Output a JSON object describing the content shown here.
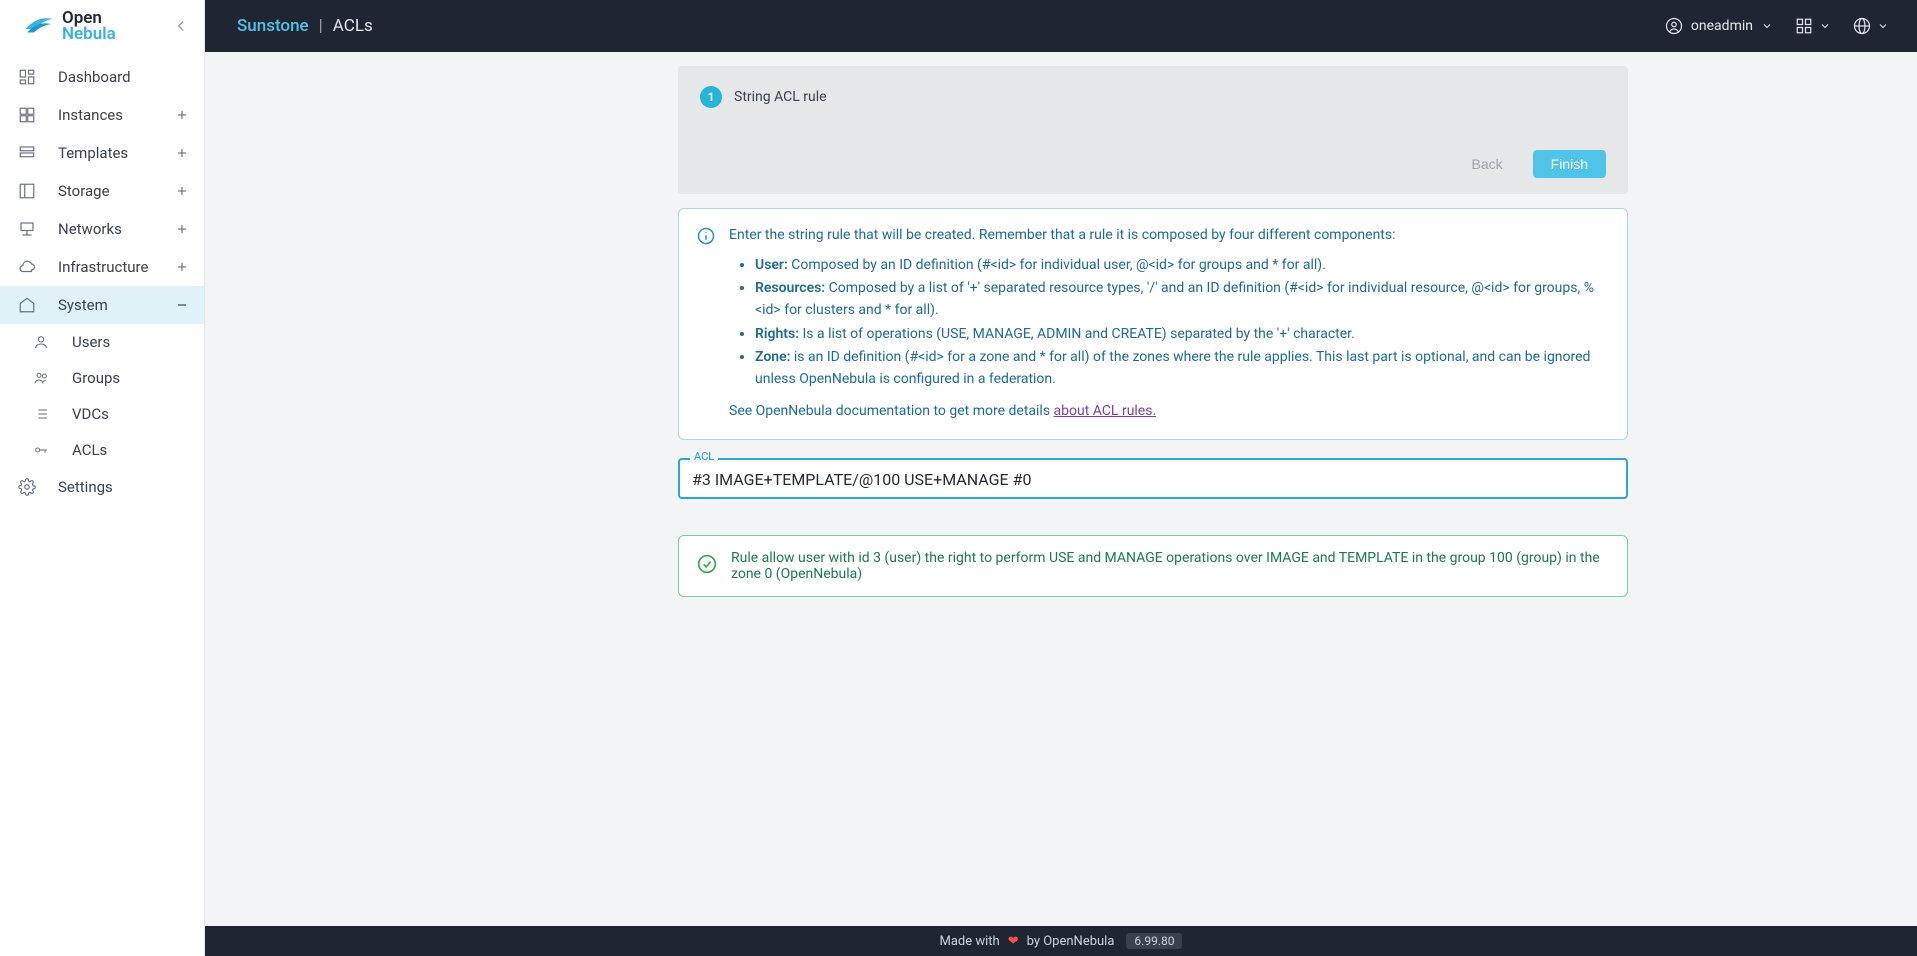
{
  "app": {
    "open": "Open",
    "nebula": "Nebula"
  },
  "breadcrumb": {
    "app": "Sunstone",
    "sep": "|",
    "page": "ACLs"
  },
  "topbar": {
    "user": "oneadmin"
  },
  "sidebar": {
    "dashboard": "Dashboard",
    "instances": "Instances",
    "templates": "Templates",
    "storage": "Storage",
    "networks": "Networks",
    "infrastructure": "Infrastructure",
    "system": "System",
    "users": "Users",
    "groups": "Groups",
    "vdcs": "VDCs",
    "acls": "ACLs",
    "settings": "Settings"
  },
  "wizard": {
    "step_num": "1",
    "step_title": "String ACL rule",
    "back": "Back",
    "finish": "Finish"
  },
  "info": {
    "intro": "Enter the string rule that will be created. Remember that a rule it is composed by four different components:",
    "user_k": "User:",
    "user_v": " Composed by an ID definition (#<id> for individual user, @<id> for groups and * for all).",
    "res_k": "Resources:",
    "res_v": " Composed by a list of '+' separated resource types, '/' and an ID definition (#<id> for individual resource, @<id> for groups, %<id> for clusters and * for all).",
    "rights_k": "Rights:",
    "rights_v": " Is a list of operations (USE, MANAGE, ADMIN and CREATE) separated by the '+' character.",
    "zone_k": "Zone:",
    "zone_v": " is an ID definition (#<id> for a zone and * for all) of the zones where the rule applies. This last part is optional, and can be ignored unless OpenNebula is configured in a federation.",
    "doc_prefix": "See OpenNebula documentation to get more details ",
    "doc_link": "about ACL rules."
  },
  "field": {
    "label": "ACL",
    "value": "#3 IMAGE+TEMPLATE/@100 USE+MANAGE #0"
  },
  "success": {
    "text": "Rule allow user with id 3 (user) the right to perform USE and MANAGE operations over IMAGE and TEMPLATE in the group 100 (group) in the zone 0 (OpenNebula)"
  },
  "footer": {
    "made": "Made with",
    "by": "by OpenNebula",
    "version": "6.99.80"
  }
}
